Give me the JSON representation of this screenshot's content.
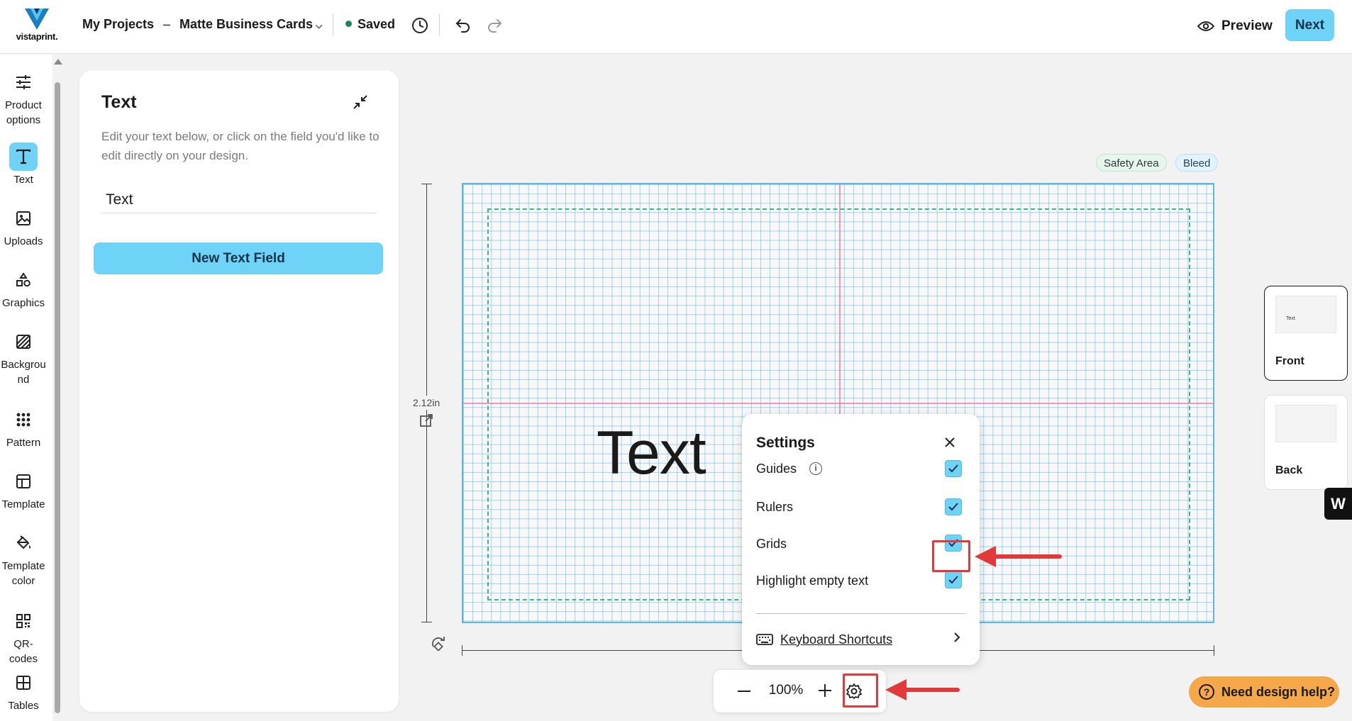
{
  "header": {
    "logo_text": "vistaprint.",
    "breadcrumb_root": "My Projects",
    "breadcrumb_sep": "–",
    "document_name": "Matte Business Cards",
    "save_status": "Saved",
    "preview_label": "Preview",
    "next_label": "Next"
  },
  "rail": {
    "items": [
      {
        "label": "Product options",
        "icon": "sliders-icon"
      },
      {
        "label": "Text",
        "icon": "text-icon",
        "active": true
      },
      {
        "label": "Uploads",
        "icon": "image-icon"
      },
      {
        "label": "Graphics",
        "icon": "shapes-icon"
      },
      {
        "label": "Backgrou nd",
        "icon": "background-icon"
      },
      {
        "label": "Pattern",
        "icon": "pattern-icon"
      },
      {
        "label": "Template",
        "icon": "template-icon"
      },
      {
        "label": "Template color",
        "icon": "paint-bucket-icon"
      },
      {
        "label": "QR-codes",
        "icon": "qr-code-icon"
      },
      {
        "label": "Tables",
        "icon": "table-icon"
      }
    ]
  },
  "panel": {
    "title": "Text",
    "description": "Edit your text below, or click on the field you'd like to edit directly on your design.",
    "field_value": "Text",
    "new_field_label": "New Text Field"
  },
  "canvas": {
    "safety_label": "Safety Area",
    "bleed_label": "Bleed",
    "height_label": "2.12in",
    "design_text": "Text",
    "zoom_value": "100%"
  },
  "settings": {
    "title": "Settings",
    "rows": [
      {
        "label": "Guides",
        "checked": true,
        "has_info": true
      },
      {
        "label": "Rulers",
        "checked": true
      },
      {
        "label": "Grids",
        "checked": true
      },
      {
        "label": "Highlight empty text",
        "checked": true
      }
    ],
    "keyboard_shortcuts_label": "Keyboard Shortcuts"
  },
  "sides": {
    "front_label": "Front",
    "front_preview_text": "Text",
    "back_label": "Back"
  },
  "help": {
    "label": "Need design help?"
  },
  "colors": {
    "accent": "#6fd3f7",
    "annotation_red": "#e23a3a",
    "help_orange": "#f5a84a",
    "grid_blue": "#53b4e6",
    "guide_pink": "#f078a0",
    "safety_green": "#3fb38a"
  }
}
